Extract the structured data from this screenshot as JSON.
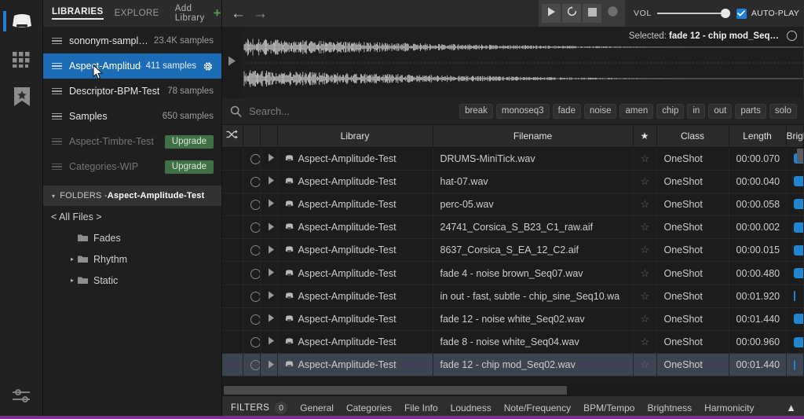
{
  "rail": {
    "items": [
      {
        "name": "drive-icon",
        "label": "Libraries",
        "active": true
      },
      {
        "name": "grid-icon",
        "label": "Browse",
        "active": false
      },
      {
        "name": "bookmark-star-icon",
        "label": "Favorites",
        "active": false
      }
    ],
    "bottom": {
      "name": "sliders-icon",
      "label": "Settings"
    }
  },
  "sidebar": {
    "tabs": {
      "libraries": "LIBRARIES",
      "explore": "EXPLORE",
      "add_library": "Add Library",
      "add_icon": "plus-icon"
    },
    "libraries": [
      {
        "name": "sononym-sampl…",
        "count": "23.4K samples",
        "state": "normal"
      },
      {
        "name": "Aspect-Amplitude-…",
        "count": "411 samples",
        "state": "selected",
        "gear": "gear-icon"
      },
      {
        "name": "Descriptor-BPM-Test",
        "count": "78 samples",
        "state": "normal"
      },
      {
        "name": "Samples",
        "count": "650 samples",
        "state": "normal"
      },
      {
        "name": "Aspect-Timbre-Test",
        "count": "",
        "state": "disabled",
        "action": "Upgrade"
      },
      {
        "name": "Categories-WIP",
        "count": "",
        "state": "disabled",
        "action": "Upgrade"
      }
    ],
    "folders_header": {
      "prefix": "FOLDERS - ",
      "library": "Aspect-Amplitude-Test",
      "caret": "triangle-down-icon"
    },
    "folders": [
      {
        "label": "< All Files >",
        "indent": 0,
        "expandable": false,
        "folder_icon": false
      },
      {
        "label": "Fades",
        "indent": 1,
        "expandable": false,
        "folder_icon": true
      },
      {
        "label": "Rhythm",
        "indent": 1,
        "expandable": true,
        "folder_icon": true
      },
      {
        "label": "Static",
        "indent": 1,
        "expandable": true,
        "folder_icon": true
      }
    ]
  },
  "topbar": {
    "back_icon": "arrow-left-icon",
    "forward_icon": "arrow-right-icon",
    "transport": [
      {
        "name": "play-button",
        "icon": "play-icon"
      },
      {
        "name": "loop-button",
        "icon": "loop-icon"
      },
      {
        "name": "stop-button",
        "icon": "stop-icon"
      },
      {
        "name": "record-button",
        "icon": "record-icon"
      }
    ],
    "volume": {
      "label": "VOL",
      "value": 100
    },
    "autoplay": {
      "label": "AUTO-PLAY",
      "checked": true
    }
  },
  "waveform": {
    "play_icon": "play-icon",
    "selected_prefix": "Selected: ",
    "selected_file": "fade 12 - chip mod_Seq…",
    "loop_toggle": "circle-icon"
  },
  "search": {
    "icon": "search-icon",
    "placeholder": "Search...",
    "value": "",
    "tags": [
      "break",
      "monoseq3",
      "fade",
      "noise",
      "amen",
      "chip",
      "in",
      "out",
      "parts",
      "solo"
    ]
  },
  "table": {
    "columns": [
      {
        "key": "shuffle",
        "label": "",
        "icon": "shuffle-icon"
      },
      {
        "key": "radio",
        "label": ""
      },
      {
        "key": "play",
        "label": ""
      },
      {
        "key": "library",
        "label": "Library"
      },
      {
        "key": "filename",
        "label": "Filename"
      },
      {
        "key": "star",
        "label": "",
        "icon": "star-icon"
      },
      {
        "key": "class",
        "label": "Class"
      },
      {
        "key": "length",
        "label": "Length"
      },
      {
        "key": "brightness",
        "label": "Brightnes"
      }
    ],
    "rows": [
      {
        "library": "Aspect-Amplitude-Test",
        "filename": "DRUMS-MiniTick.wav",
        "class": "OneShot",
        "length": "00:00.070",
        "brightness": 82,
        "selected": false
      },
      {
        "library": "Aspect-Amplitude-Test",
        "filename": "hat-07.wav",
        "class": "OneShot",
        "length": "00:00.040",
        "brightness": 95,
        "selected": false
      },
      {
        "library": "Aspect-Amplitude-Test",
        "filename": "perc-05.wav",
        "class": "OneShot",
        "length": "00:00.058",
        "brightness": 72,
        "selected": false
      },
      {
        "library": "Aspect-Amplitude-Test",
        "filename": "24741_Corsica_S_B23_C1_raw.aif",
        "class": "OneShot",
        "length": "00:00.002",
        "brightness": 45,
        "selected": false
      },
      {
        "library": "Aspect-Amplitude-Test",
        "filename": "8637_Corsica_S_EA_12_C2.aif",
        "class": "OneShot",
        "length": "00:00.015",
        "brightness": 43,
        "selected": false
      },
      {
        "library": "Aspect-Amplitude-Test",
        "filename": "fade 4 - noise brown_Seq07.wav",
        "class": "OneShot",
        "length": "00:00.480",
        "brightness": 38,
        "selected": false
      },
      {
        "library": "Aspect-Amplitude-Test",
        "filename": "in out - fast, subtle - chip_sine_Seq10.wa",
        "class": "OneShot",
        "length": "00:01.920",
        "brightness": 4,
        "selected": false
      },
      {
        "library": "Aspect-Amplitude-Test",
        "filename": "fade 12 - noise white_Seq02.wav",
        "class": "OneShot",
        "length": "00:01.440",
        "brightness": 88,
        "selected": false
      },
      {
        "library": "Aspect-Amplitude-Test",
        "filename": "fade 8 - noise white_Seq04.wav",
        "class": "OneShot",
        "length": "00:00.960",
        "brightness": 88,
        "selected": false
      },
      {
        "library": "Aspect-Amplitude-Test",
        "filename": "fade 12 - chip mod_Seq02.wav",
        "class": "OneShot",
        "length": "00:01.440",
        "brightness": 4,
        "selected": true
      }
    ]
  },
  "filters": {
    "label": "FILTERS",
    "count": "0",
    "items": [
      "General",
      "Categories",
      "File Info",
      "Loudness",
      "Note/Frequency",
      "BPM/Tempo",
      "Brightness",
      "Harmonicity"
    ],
    "collapse_icon": "chevron-up-icon"
  },
  "colors": {
    "accent_blue": "#1c6cb5",
    "bar_blue": "#1f85d0",
    "upgrade_green": "#3f7046",
    "bottom_accent": "#7a2f8a"
  }
}
